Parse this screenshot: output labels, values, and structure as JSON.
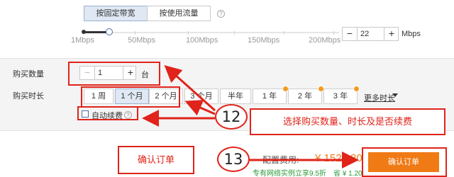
{
  "bandwidth": {
    "tabs": [
      {
        "label": "按固定带宽",
        "selected": true
      },
      {
        "label": "按使用流量",
        "selected": false
      }
    ],
    "help_glyph": "?",
    "ticks": [
      "1Mbps",
      "50Mbps",
      "100Mbps",
      "150Mbps",
      "200Mbps"
    ],
    "slider_value_mbps": 22,
    "stepper": {
      "minus": "−",
      "value": "22",
      "plus": "+"
    },
    "unit": "Mbps"
  },
  "purchase": {
    "quantity_label": "购买数量",
    "quantity": {
      "minus": "−",
      "value": "1",
      "plus": "+",
      "unit": "台"
    },
    "duration_label": "购买时长",
    "durations": [
      {
        "label": "1 周",
        "selected": false,
        "badge": false
      },
      {
        "label": "1 个月",
        "selected": true,
        "badge": false
      },
      {
        "label": "2 个月",
        "selected": false,
        "badge": false
      },
      {
        "label": "3 个月",
        "selected": false,
        "badge": false
      },
      {
        "label": "半年",
        "selected": false,
        "badge": false
      },
      {
        "label": "1 年",
        "selected": false,
        "badge": true
      },
      {
        "label": "2 年",
        "selected": false,
        "badge": true
      },
      {
        "label": "3 年",
        "selected": false,
        "badge": true
      }
    ],
    "more_label": "更多时长",
    "auto_renew": {
      "label": "自动续费",
      "checked": false,
      "help_glyph": "?"
    }
  },
  "annotations": {
    "step12": "12",
    "step12_text": "选择购买数量、时长及是否续费",
    "step13": "13",
    "step13_text": "确认订单"
  },
  "footer": {
    "price_label": "配置费用:",
    "price_value": "¥ 1521.80",
    "promo": "专有网络实例立享9.5折",
    "save": "省 ¥ 1.20",
    "confirm_button": "确认订单"
  },
  "colors": {
    "accent_orange": "#f07a14",
    "annotation_red": "#e0231b",
    "promo_green": "#2d9a3a",
    "selected_bg": "#dfe8f3"
  }
}
